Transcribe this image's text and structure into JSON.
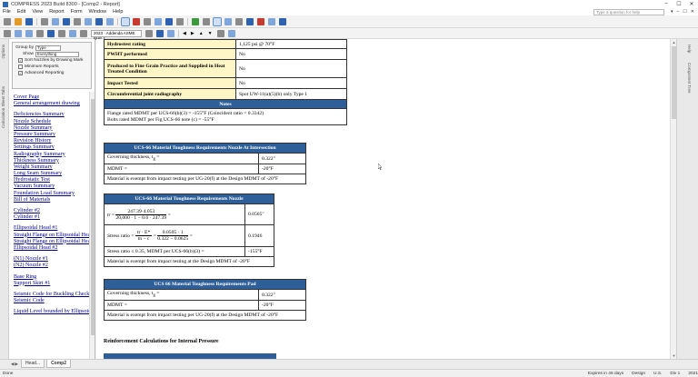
{
  "window": {
    "title": "COMPRESS 2023 Build 8300 - [Comp2 - Report]",
    "minimize": "–",
    "maximize": "☐",
    "close": "✕"
  },
  "menu": {
    "items": [
      "File",
      "Edit",
      "View",
      "Report",
      "Form",
      "Window",
      "Help"
    ],
    "help_search_placeholder": "Type a question for help",
    "right_controls": [
      "▾",
      "–",
      "☐",
      "✕"
    ]
  },
  "toolbar2": {
    "addenda_dropdown": "2023 · Addenda ASME BHE 1",
    "arrows": [
      "◀",
      "▶",
      "▲",
      "▼"
    ]
  },
  "left_strip": {
    "tabs": [
      "Options",
      "Calculation Sheet Tabs"
    ]
  },
  "options": {
    "group_by_label": "Group by",
    "group_by_value": "Type",
    "show_label": "Show",
    "show_value": "Everything",
    "checks": [
      {
        "label": "Sort Nozzles by Drawing Mark",
        "checked": true
      },
      {
        "label": "Minimum Reports",
        "checked": false
      },
      {
        "label": "Advanced Reporting",
        "checked": true
      }
    ]
  },
  "nav": {
    "group1": [
      "Cover Page",
      "General arrangement drawing"
    ],
    "group2": [
      "Deficiencies Summary",
      "Nozzle Schedule",
      "Nozzle Summary",
      "Pressure Summary",
      "Revision History",
      "Settings Summary",
      "Radiography Summary",
      "Thickness Summary",
      "Weight Summary",
      "Long Seam Summary",
      "Hydrostatic Test",
      "Vacuum Summary",
      "Foundation Load Summary",
      "Bill of Materials"
    ],
    "group3": [
      "Cylinder #2",
      "Cylinder #1"
    ],
    "group4": [
      "Ellipsoidal Head #1",
      "Straight Flange on Ellipsoidal Head",
      "Straight Flange on Ellipsoidal Head",
      "Ellipsoidal Head #2"
    ],
    "group5": [
      "(N1) Nozzle #1",
      "(N2) Nozzle #2"
    ],
    "group6": [
      "Base Ring",
      "Support Skirt #1"
    ],
    "group7": [
      "Seismic Code for Buckling Check",
      "Seismic Code"
    ],
    "group8": [
      "Liquid Level bounded by Ellipsoidal"
    ]
  },
  "report": {
    "top_table": {
      "rows": [
        {
          "label": "Hydrostest rating",
          "value": "1,125 psi @ 70°F"
        },
        {
          "label": "PWHT performed",
          "value": "No"
        },
        {
          "label": "Produced to Fine Grain Practice and Supplied in Heat Treated Condition",
          "value": "No"
        },
        {
          "label": "Impact Tested",
          "value": "No"
        },
        {
          "label": "Circumferential joint radiography",
          "value": "Spot UW-11(a)(5)(b) only Type 1"
        }
      ],
      "notes_header": "Notes",
      "notes": [
        "Flange rated MDMT per UCS-66(b)(3) = -155°F (Coincident ratio = 0.3342)",
        "Bolts rated MDMT per Fig UCS-66 note (c) = -55°F"
      ]
    },
    "ucs66_intersection": {
      "header": "UCS-66 Material Toughness Requirements Nozzle At Intersection",
      "rows": [
        {
          "label": "Governing thickness, t",
          "sub": "g",
          "suffix": " =",
          "value": "0.322\""
        },
        {
          "label": "MDMT =",
          "sub": "",
          "suffix": "",
          "value": "-20°F"
        }
      ],
      "note": "Material is exempt from impact testing per UG-20(f) at the Design MDMT of -20°F"
    },
    "ucs66_nozzle": {
      "header": "UCS-66 Material Toughness Requirements Nozzle",
      "tr_lhs": "tr =",
      "tr_num": "247.39·4.053",
      "tr_den": "20,000 · 1 − 0.6 · 247.39",
      "tr_eq": "=",
      "tr_value": "0.0505\"",
      "stress_lhs": "Stress ratio =",
      "stress_num1": "tr · E*",
      "stress_den1": "tn − c",
      "stress_eq1": "=",
      "stress_num2": "0.0505 · 1",
      "stress_den2": "0.322 − 0.0625",
      "stress_eq2": "=",
      "stress_value": "0.1946",
      "ratio_label": "Stress ratio ≤ 0.35, MDMT per UCS-66(b)(3) =",
      "ratio_value": "-155°F",
      "note": "Material is exempt from impact testing at the Design MDMT of -20°F"
    },
    "ucs66_pad": {
      "header": "UCS 66 Material Toughness Requirements Pad",
      "rows": [
        {
          "label": "Governing thickness, t",
          "sub": "g",
          "suffix": " =",
          "value": "0.322\""
        },
        {
          "label": "MDMT =",
          "sub": "",
          "suffix": "",
          "value": "-20°F"
        }
      ],
      "note": "Material is exempt from impact testing per UG-20(f) at the Design MDMT of -20°F"
    },
    "reinforcement_title": "Reinforcement Calculations for Internal Pressure"
  },
  "right_strip": {
    "tabs": [
      "Help",
      "Component Tree"
    ]
  },
  "tabs": {
    "items": [
      "Head...",
      "Comp2"
    ],
    "active": "Comp2"
  },
  "status": {
    "left": "Done",
    "right": [
      "Expires in 46 days",
      "Design",
      "U.S.",
      "Div 1",
      "2021"
    ]
  },
  "colors": {
    "header_blue": "#2e5f99",
    "label_yellow": "#fff6c8",
    "link_blue": "#00008b"
  }
}
